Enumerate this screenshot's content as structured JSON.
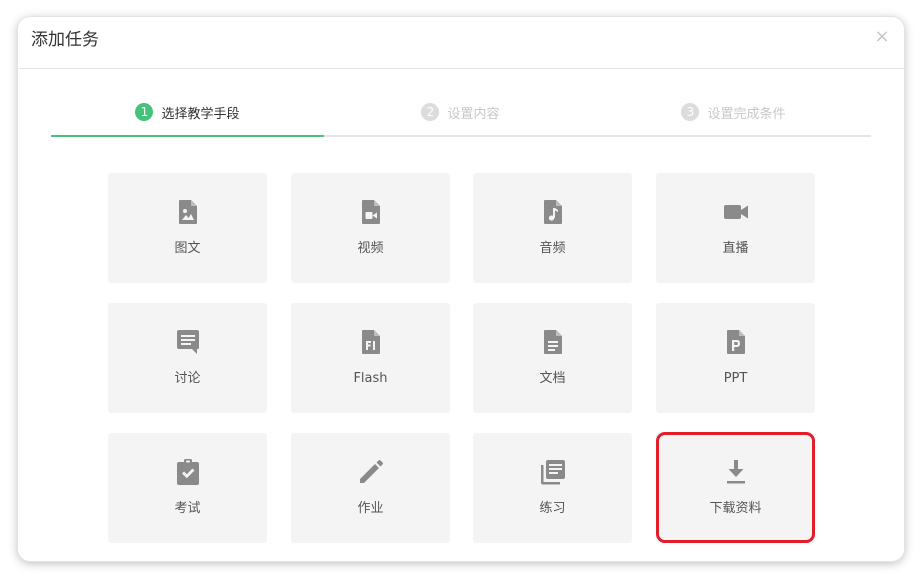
{
  "modal": {
    "title": "添加任务",
    "close_glyph": "×"
  },
  "steps": [
    {
      "number": "1",
      "label": "选择教学手段",
      "state": "active"
    },
    {
      "number": "2",
      "label": "设置内容",
      "state": "inactive"
    },
    {
      "number": "3",
      "label": "设置完成条件",
      "state": "inactive"
    }
  ],
  "colors": {
    "accent": "#46c37b",
    "highlight": "#e31e2a",
    "icon": "#8a8a8a",
    "tile_bg": "#f4f4f4"
  },
  "tiles": [
    {
      "label": "图文",
      "icon": "image-file-icon"
    },
    {
      "label": "视频",
      "icon": "video-file-icon"
    },
    {
      "label": "音频",
      "icon": "audio-file-icon"
    },
    {
      "label": "直播",
      "icon": "video-camera-icon"
    },
    {
      "label": "讨论",
      "icon": "comment-icon"
    },
    {
      "label": "Flash",
      "icon": "flash-file-icon"
    },
    {
      "label": "文档",
      "icon": "document-file-icon"
    },
    {
      "label": "PPT",
      "icon": "ppt-file-icon"
    },
    {
      "label": "考试",
      "icon": "clipboard-check-icon"
    },
    {
      "label": "作业",
      "icon": "pencil-icon"
    },
    {
      "label": "练习",
      "icon": "library-books-icon"
    },
    {
      "label": "下载资料",
      "icon": "download-icon"
    }
  ]
}
